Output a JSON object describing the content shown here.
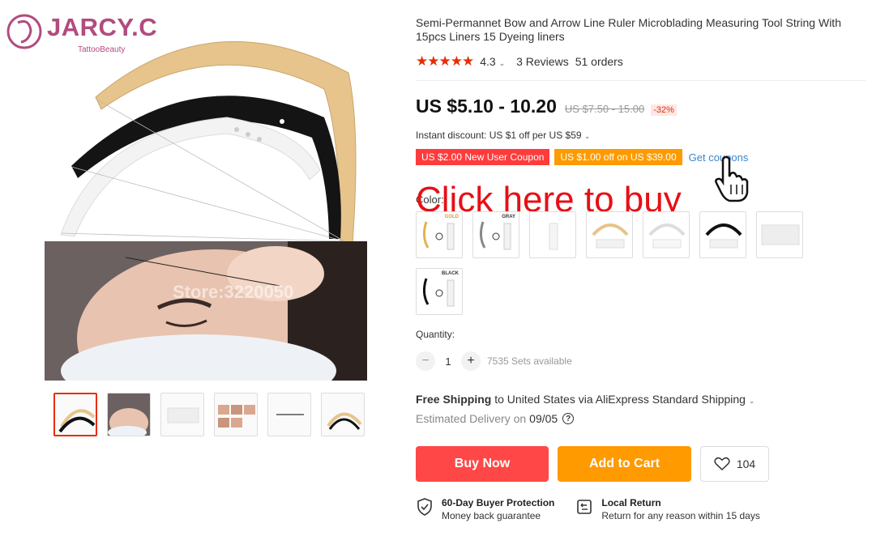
{
  "brand": {
    "name": "JARCY.C",
    "tagline": "TattooBeauty"
  },
  "gallery": {
    "watermark": "Store:3220050",
    "thumbnail_count": 6
  },
  "product": {
    "title": "Semi-Permannet Bow and Arrow Line Ruler Microblading Measuring Tool String With 15pcs Liners 15 Dyeing liners",
    "rating": "4.3",
    "reviews": "3 Reviews",
    "orders": "51 orders"
  },
  "price": {
    "current": "US $5.10 - 10.20",
    "original": "US $7.50 - 15.00",
    "discount": "-32%"
  },
  "promo": {
    "instant_discount": "Instant discount: US $1 off per US $59",
    "coupon_new_user": "US $2.00 New User Coupon",
    "coupon_order": "US $1.00 off on US $39.00",
    "get_coupons": "Get coupons"
  },
  "overlay": {
    "text": "Click here to buy"
  },
  "color": {
    "label": "Color:",
    "swatch_tags": [
      "GOLD",
      "GRAY",
      "",
      "",
      "",
      "",
      "",
      "BLACK"
    ]
  },
  "quantity": {
    "label": "Quantity:",
    "value": "1",
    "minus": "−",
    "plus": "+",
    "available": "7535 Sets available"
  },
  "shipping": {
    "free": "Free Shipping",
    "rest": " to United States via AliExpress Standard Shipping",
    "delivery_label": "Estimated Delivery on",
    "delivery_date": "09/05"
  },
  "actions": {
    "buy_now": "Buy Now",
    "add_to_cart": "Add to Cart",
    "wishlist_count": "104"
  },
  "guarantees": {
    "protection_title": "60-Day Buyer Protection",
    "protection_sub": "Money back guarantee",
    "return_title": "Local Return",
    "return_sub": "Return for any reason within 15 days"
  },
  "colors": {
    "accent_red": "#e62e04",
    "buy": "#ff4747",
    "cart": "#ff9a00",
    "link": "#3a85d0",
    "brand": "#b24b7e"
  }
}
